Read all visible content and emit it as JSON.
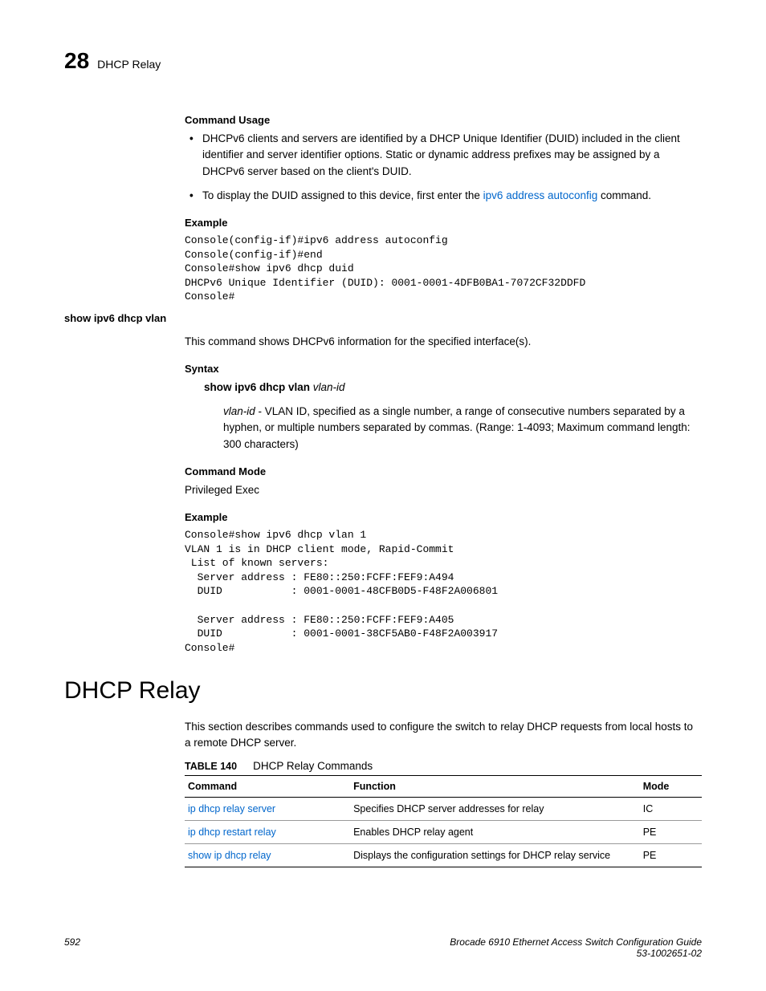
{
  "header": {
    "chapter_number": "28",
    "chapter_title": "DHCP Relay"
  },
  "command_usage": {
    "heading": "Command Usage",
    "bullets": [
      {
        "text": "DHCPv6 clients and servers are identified by a DHCP Unique Identifier (DUID) included in the client identifier and server identifier options. Static or dynamic address prefixes may be assigned by a DHCPv6 server based on the client's DUID."
      },
      {
        "prefix": "To display the DUID assigned to this device, first enter the ",
        "link": "ipv6 address autoconfig",
        "suffix": " command."
      }
    ]
  },
  "example1": {
    "heading": "Example",
    "code": "Console(config-if)#ipv6 address autoconfig\nConsole(config-if)#end\nConsole#show ipv6 dhcp duid\nDHCPv6 Unique Identifier (DUID): 0001-0001-4DFB0BA1-7072CF32DDFD\nConsole#"
  },
  "show_vlan": {
    "name": "show ipv6 dhcp vlan",
    "description": "This command shows DHCPv6 information for the specified interface(s).",
    "syntax_heading": "Syntax",
    "syntax_cmd": "show ipv6 dhcp vlan",
    "syntax_param": "vlan-id",
    "param_name": "vlan-id",
    "param_desc": " - VLAN ID, specified as a single number, a range of consecutive numbers separated by a hyphen, or multiple numbers separated by commas. (Range: 1-4093; Maximum command length: 300 characters)",
    "mode_heading": "Command Mode",
    "mode_value": "Privileged Exec",
    "example_heading": "Example",
    "example_code": "Console#show ipv6 dhcp vlan 1\nVLAN 1 is in DHCP client mode, Rapid-Commit\n List of known servers:\n  Server address : FE80::250:FCFF:FEF9:A494\n  DUID           : 0001-0001-48CFB0D5-F48F2A006801\n\n  Server address : FE80::250:FCFF:FEF9:A405\n  DUID           : 0001-0001-38CF5AB0-F48F2A003917\nConsole#"
  },
  "dhcp_relay": {
    "heading": "DHCP Relay",
    "intro": "This section describes commands used to configure the switch to relay DHCP requests from local hosts to a remote DHCP server.",
    "table_number": "TABLE 140",
    "table_caption": "DHCP Relay Commands",
    "columns": {
      "c1": "Command",
      "c2": "Function",
      "c3": "Mode"
    },
    "rows": [
      {
        "cmd": "ip dhcp relay server",
        "func": "Specifies DHCP server addresses for relay",
        "mode": "IC"
      },
      {
        "cmd": "ip dhcp restart relay",
        "func": "Enables DHCP relay agent",
        "mode": "PE"
      },
      {
        "cmd": "show ip dhcp relay",
        "func": "Displays the configuration settings for DHCP relay service",
        "mode": "PE"
      }
    ]
  },
  "footer": {
    "page": "592",
    "title": "Brocade 6910 Ethernet Access Switch Configuration Guide",
    "docnum": "53-1002651-02"
  }
}
